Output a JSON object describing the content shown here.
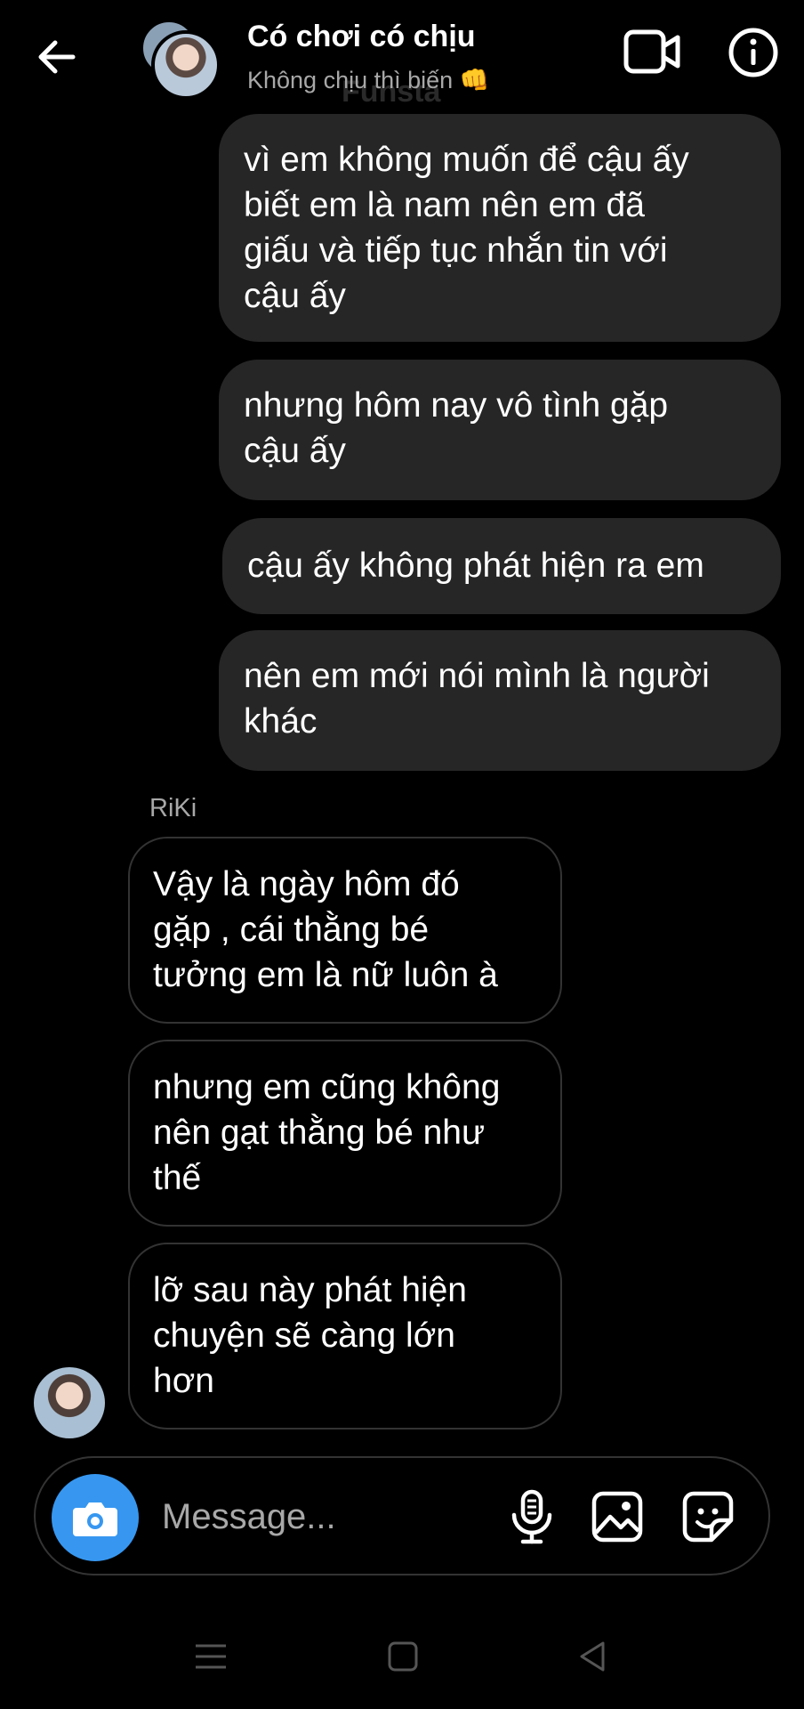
{
  "header": {
    "title": "Có chơi có chịu",
    "subtitle": "Không chịu thì biến 👊",
    "watermark": "Funsta"
  },
  "sent_messages": [
    {
      "lines": [
        "vì em không muốn để cậu ấy",
        "biết em là nam nên em đã",
        "giấu và tiếp tục nhắn tin với",
        "cậu ấy"
      ]
    },
    {
      "lines": [
        "nhưng hôm nay vô tình gặp",
        "cậu ấy"
      ]
    },
    {
      "lines": [
        "cậu ấy không phát hiện ra em"
      ]
    },
    {
      "lines": [
        "nên em mới nói mình là người",
        "khác"
      ]
    }
  ],
  "received": {
    "sender_name": "RiKi",
    "messages": [
      {
        "lines": [
          "Vậy là ngày hôm đó",
          "gặp , cái thằng bé",
          "tưởng em là nữ luôn à"
        ]
      },
      {
        "lines": [
          "nhưng em cũng không",
          "nên gạt thằng bé như",
          "thế"
        ]
      },
      {
        "lines": [
          "lỡ sau này phát hiện",
          "chuyện sẽ càng lớn",
          "hơn"
        ]
      }
    ]
  },
  "composer": {
    "placeholder": "Message..."
  },
  "icons": {
    "back": "back-arrow-icon",
    "video": "video-call-icon",
    "info": "info-icon",
    "camera": "camera-icon",
    "mic": "microphone-icon",
    "gallery": "gallery-icon",
    "sticker": "sticker-icon"
  },
  "colors": {
    "background": "#000000",
    "sent_bubble": "#262626",
    "received_border": "#333333",
    "camera_button": "#3797f0",
    "secondary_text": "#a8a8a8"
  }
}
